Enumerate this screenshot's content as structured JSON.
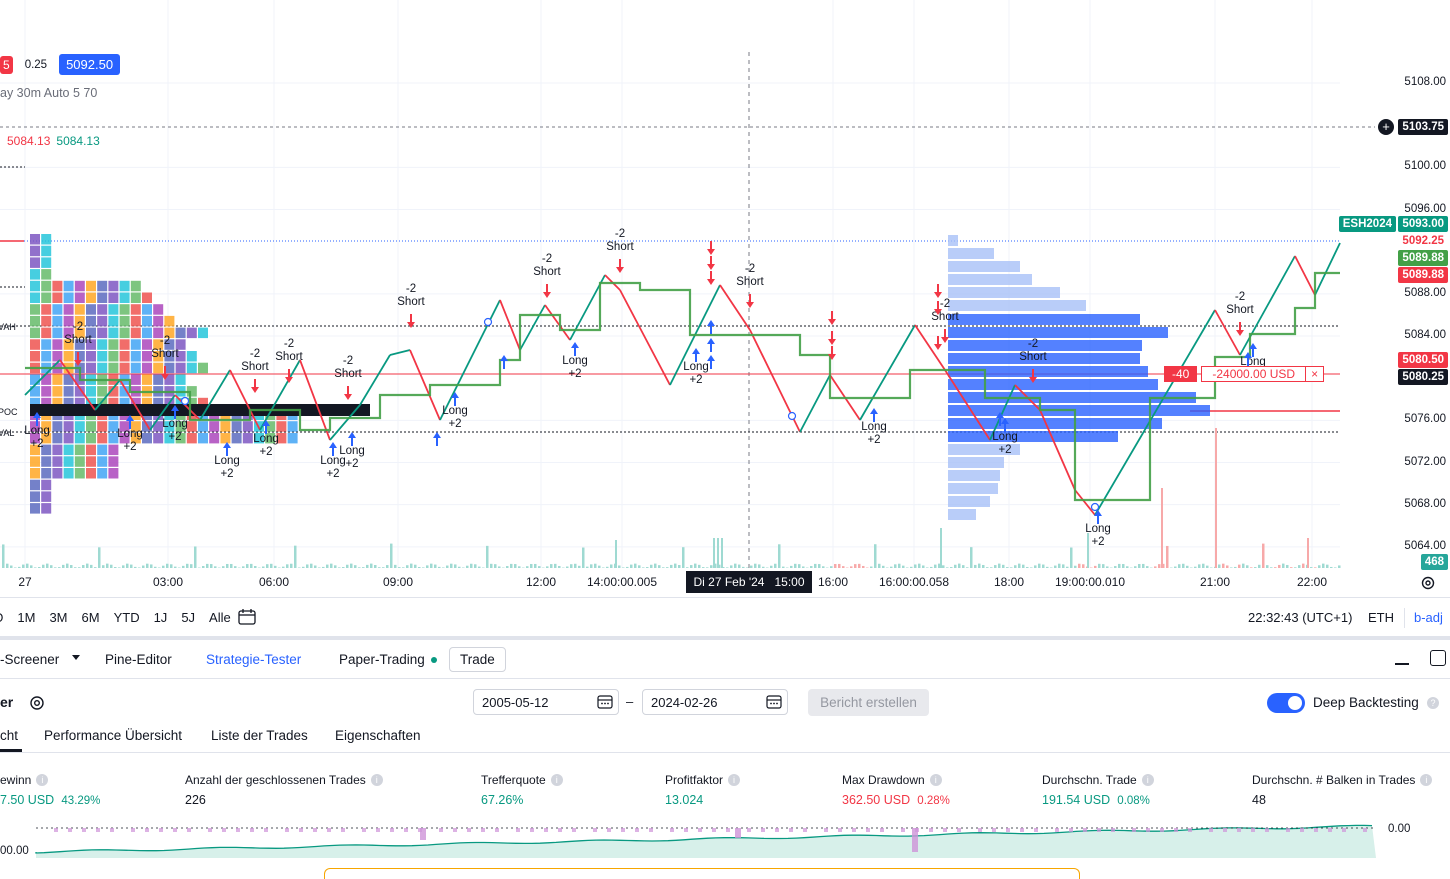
{
  "legend": {
    "badge_left": "5",
    "spread": "0.25",
    "buy_price": "5092.50",
    "indicator": "ay 30m Auto 5 70",
    "ma_red": "5084.13",
    "ma_green": "5084.13"
  },
  "price_axis": {
    "ticks": [
      "5108.00",
      "5100.00",
      "5096.00",
      "5088.00",
      "5084.00",
      "5076.00",
      "5072.00",
      "5068.00",
      "5064.00"
    ],
    "crosshair_price": "5103.75",
    "symbol": "ESH2024",
    "last_price": "5093.00",
    "tags": [
      {
        "text": "5092.25",
        "color": "#f23645",
        "bg": "#ffffff"
      },
      {
        "text": "5089.88",
        "color": "#ffffff",
        "bg": "#43a047"
      },
      {
        "text": "5089.88",
        "color": "#ffffff",
        "bg": "#f23645"
      },
      {
        "text": "5080.50",
        "color": "#ffffff",
        "bg": "#f23645"
      },
      {
        "text": "5080.25",
        "color": "#ffffff",
        "bg": "#131722"
      }
    ],
    "volume_tag": "468"
  },
  "profile_labels": {
    "vah": "VAH",
    "poc": "POC",
    "val": "VAL"
  },
  "time_axis": {
    "labels": [
      "27",
      "03:00",
      "06:00",
      "09:00",
      "12:00",
      "14:00:00.005",
      "16:00",
      "16:00:00.058",
      "18:00",
      "19:00:00.010",
      "21:00",
      "22:00"
    ],
    "crosshair_time": "Di 27 Feb '24   15:00"
  },
  "position_line": {
    "qty": "-40",
    "pnl": "-24000.00 USD",
    "close": "×"
  },
  "trade_markers": [
    {
      "kind": "long",
      "label": "Long\n+2"
    },
    {
      "kind": "short",
      "label": "-2\nShort"
    }
  ],
  "marker_texts": {
    "short_lines": [
      "-2",
      "Short"
    ],
    "long_lines": [
      "Long",
      "+2"
    ],
    "short_single": "Short",
    "minus2": "-2",
    "plus2": "+2"
  },
  "range_bar": {
    "ranges": [
      "D",
      "1M",
      "3M",
      "6M",
      "YTD",
      "1J",
      "5J",
      "Alle"
    ],
    "clock": "22:32:43 (UTC+1)",
    "session": "ETH",
    "adj": "b-adj"
  },
  "bottom_tabs": {
    "items": [
      "-Screener",
      "Pine-Editor",
      "Strategie-Tester",
      "Paper-Trading",
      "Trade"
    ],
    "active": "Strategie-Tester"
  },
  "tester": {
    "title": "er",
    "date_from": "2005-05-12",
    "date_sep": "–",
    "date_to": "2024-02-26",
    "report_button": "Bericht erstellen",
    "deep_backtesting": "Deep Backtesting",
    "subtabs": [
      "cht",
      "Performance Übersicht",
      "Liste der Trades",
      "Eigenschaften"
    ]
  },
  "metrics": [
    {
      "label": "ewinn",
      "value": "7.50 USD",
      "extra": "43.29%",
      "value_color": "#089981"
    },
    {
      "label": "Anzahl der geschlossenen Trades",
      "value": "226",
      "extra": "",
      "value_color": "#131722"
    },
    {
      "label": "Trefferquote",
      "value": "67.26%",
      "extra": "",
      "value_color": "#089981"
    },
    {
      "label": "Profitfaktor",
      "value": "13.024",
      "extra": "",
      "value_color": "#089981"
    },
    {
      "label": "Max Drawdown",
      "value": "362.50 USD",
      "extra": "0.28%",
      "value_color": "#f23645"
    },
    {
      "label": "Durchschn. Trade",
      "value": "191.54 USD",
      "extra": "0.08%",
      "value_color": "#089981"
    },
    {
      "label": "Durchschn. # Balken in Trades",
      "value": "48",
      "extra": "",
      "value_color": "#131722"
    }
  ],
  "equity_axis": {
    "right": "0.00",
    "left": "00.00"
  },
  "colors": {
    "accent": "#2962ff",
    "green": "#089981",
    "red": "#f23645",
    "grid": "#f0f3fa"
  }
}
